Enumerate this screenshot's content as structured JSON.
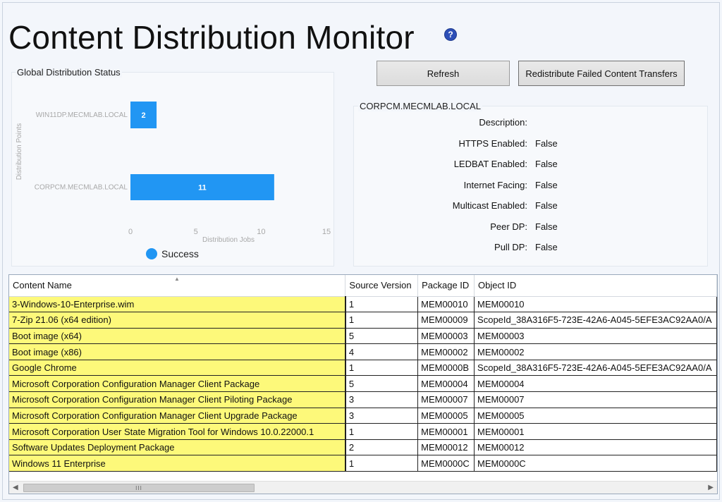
{
  "header": {
    "title": "Content Distribution Monitor",
    "help_glyph": "?"
  },
  "toolbar": {
    "refresh_label": "Refresh",
    "redistribute_label": "Redistribute Failed Content Transfers"
  },
  "status_panel": {
    "title": "Global Distribution Status"
  },
  "chart_data": {
    "type": "bar",
    "orientation": "horizontal",
    "categories": [
      "WIN11DP.MECMLAB.LOCAL",
      "CORPCM.MECMLAB.LOCAL"
    ],
    "series": [
      {
        "name": "Success",
        "values": [
          2,
          11
        ],
        "color": "#2196f3"
      }
    ],
    "xlabel": "Distribution Jobs",
    "ylabel": "Distribution Points",
    "xlim": [
      0,
      15
    ],
    "xticks": [
      0,
      5,
      10,
      15
    ],
    "legend_position": "bottom"
  },
  "dp_panel": {
    "title": "CORPCM.MECMLAB.LOCAL",
    "properties": [
      {
        "label": "Description:",
        "value": ""
      },
      {
        "label": "HTTPS Enabled:",
        "value": "False"
      },
      {
        "label": "LEDBAT Enabled:",
        "value": "False"
      },
      {
        "label": "Internet Facing:",
        "value": "False"
      },
      {
        "label": "Multicast Enabled:",
        "value": "False"
      },
      {
        "label": "Peer DP:",
        "value": "False"
      },
      {
        "label": "Pull DP:",
        "value": "False"
      }
    ]
  },
  "grid": {
    "columns": [
      "Content Name",
      "Source Version",
      "Package ID",
      "Object ID"
    ],
    "rows": [
      [
        "3-Windows-10-Enterprise.wim",
        "1",
        "MEM00010",
        "MEM00010"
      ],
      [
        "7-Zip 21.06 (x64 edition)",
        "1",
        "MEM00009",
        "ScopeId_38A316F5-723E-42A6-A045-5EFE3AC92AA0/A"
      ],
      [
        "Boot image (x64)",
        "5",
        "MEM00003",
        "MEM00003"
      ],
      [
        "Boot image (x86)",
        "4",
        "MEM00002",
        "MEM00002"
      ],
      [
        "Google Chrome",
        "1",
        "MEM0000B",
        "ScopeId_38A316F5-723E-42A6-A045-5EFE3AC92AA0/A"
      ],
      [
        "Microsoft Corporation Configuration Manager Client Package",
        "5",
        "MEM00004",
        "MEM00004"
      ],
      [
        "Microsoft Corporation Configuration Manager Client Piloting Package",
        "3",
        "MEM00007",
        "MEM00007"
      ],
      [
        "Microsoft Corporation Configuration Manager Client Upgrade Package",
        "3",
        "MEM00005",
        "MEM00005"
      ],
      [
        "Microsoft Corporation User State Migration Tool for Windows 10.0.22000.1",
        "1",
        "MEM00001",
        "MEM00001"
      ],
      [
        "Software Updates Deployment Package",
        "2",
        "MEM00012",
        "MEM00012"
      ],
      [
        "Windows 11 Enterprise",
        "1",
        "MEM0000C",
        "MEM0000C"
      ]
    ],
    "highlight_color": "#fdf97a",
    "scroll_thumb_glyph": "III"
  }
}
